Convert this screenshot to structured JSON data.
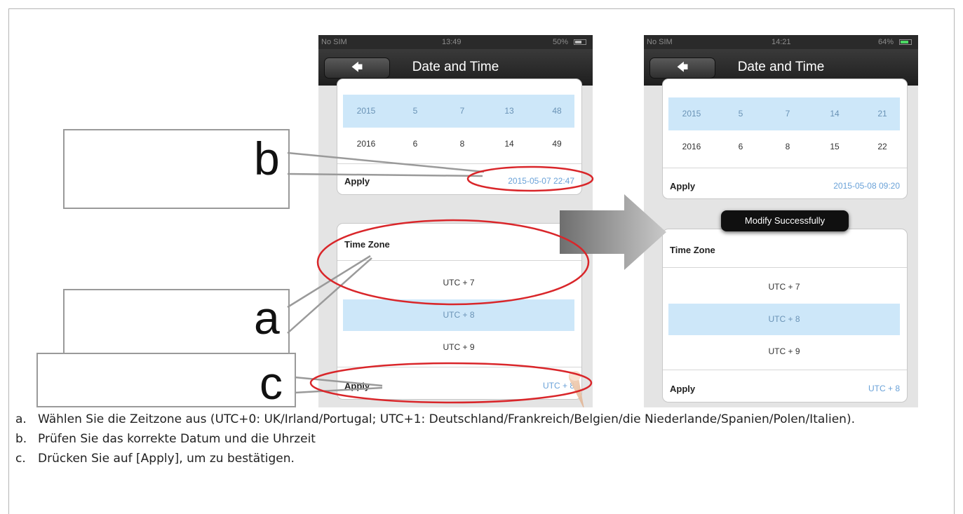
{
  "screen_left": {
    "status": {
      "carrier": "No SIM",
      "time": "13:49",
      "battery": "50%"
    },
    "nav": {
      "back_icon": "back-arrow-icon",
      "title": "Date and Time"
    },
    "date_rows": [
      {
        "values": [
          "2015",
          "5",
          "7",
          "13",
          "48"
        ],
        "selected": true
      },
      {
        "values": [
          "2016",
          "6",
          "8",
          "14",
          "49"
        ],
        "selected": false
      }
    ],
    "date_apply": {
      "label": "Apply",
      "value": "2015-05-07 22:47"
    },
    "timezone": {
      "title": "Time Zone",
      "options": [
        "UTC + 7",
        "UTC + 8",
        "UTC + 9"
      ],
      "selected": "UTC + 8",
      "apply_label": "Apply",
      "apply_value": "UTC + 8"
    }
  },
  "screen_right": {
    "status": {
      "carrier": "No SIM",
      "time": "14:21",
      "battery": "64%"
    },
    "nav": {
      "back_icon": "back-arrow-icon",
      "title": "Date and Time"
    },
    "date_rows": [
      {
        "values": [
          "2015",
          "5",
          "7",
          "14",
          "21"
        ],
        "selected": true
      },
      {
        "values": [
          "2016",
          "6",
          "8",
          "15",
          "22"
        ],
        "selected": false
      }
    ],
    "date_apply": {
      "label": "Apply",
      "value": "2015-05-08 09:20"
    },
    "toast": "Modify Successfully",
    "timezone": {
      "title": "Time Zone",
      "options": [
        "UTC + 7",
        "UTC + 8",
        "UTC + 9"
      ],
      "selected": "UTC + 8",
      "apply_label": "Apply",
      "apply_value": "UTC + 8"
    }
  },
  "callouts": {
    "a": "a",
    "b": "b",
    "c": "c"
  },
  "instructions": [
    {
      "letter": "a.",
      "text": "Wählen Sie die Zeitzone aus (UTC+0: UK/Irland/Portugal; UTC+1: Deutschland/Frankreich/Belgien/die Niederlande/Spanien/Polen/Italien)."
    },
    {
      "letter": "b.",
      "text": "Prüfen Sie das korrekte Datum und die Uhrzeit"
    },
    {
      "letter": "c.",
      "text": "Drücken Sie auf [Apply], um zu bestätigen."
    }
  ],
  "colors": {
    "highlight": "#cde7f9",
    "apply_value": "#6aa2d8",
    "annotation": "#d9262a",
    "battery_right": "#4cd964"
  }
}
